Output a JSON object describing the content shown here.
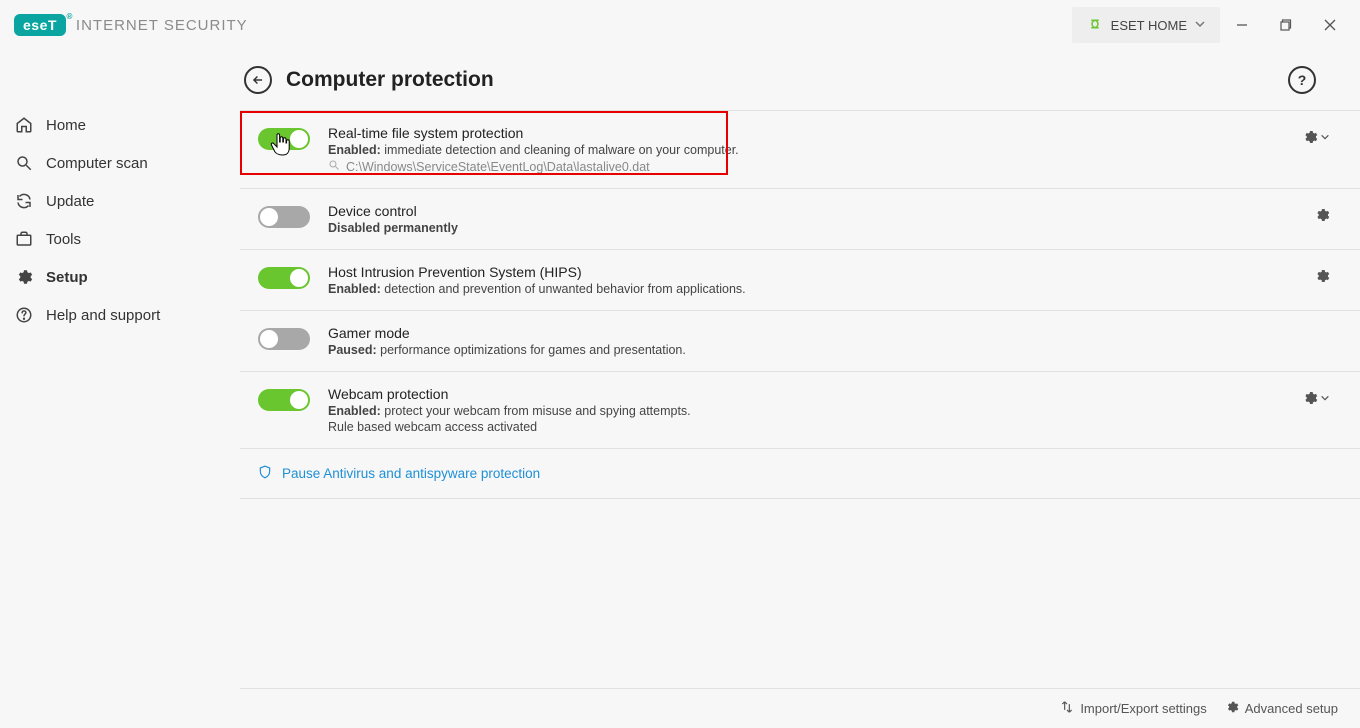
{
  "brand": {
    "logo_text": "eseT",
    "product": "INTERNET SECURITY"
  },
  "titlebar": {
    "home_button": "ESET HOME"
  },
  "sidebar": {
    "items": [
      {
        "label": "Home"
      },
      {
        "label": "Computer scan"
      },
      {
        "label": "Update"
      },
      {
        "label": "Tools"
      },
      {
        "label": "Setup"
      },
      {
        "label": "Help and support"
      }
    ]
  },
  "page": {
    "title": "Computer protection",
    "rows": [
      {
        "title": "Real-time file system protection",
        "status_label": "Enabled:",
        "status_text": "immediate detection and cleaning of malware on your computer.",
        "extra": "C:\\Windows\\ServiceState\\EventLog\\Data\\lastalive0.dat"
      },
      {
        "title": "Device control",
        "status_label": "Disabled permanently",
        "status_text": ""
      },
      {
        "title": "Host Intrusion Prevention System (HIPS)",
        "status_label": "Enabled:",
        "status_text": "detection and prevention of unwanted behavior from applications."
      },
      {
        "title": "Gamer mode",
        "status_label": "Paused:",
        "status_text": "performance optimizations for games and presentation."
      },
      {
        "title": "Webcam protection",
        "status_label": "Enabled:",
        "status_text": "protect your webcam from misuse and spying attempts.",
        "extra2": "Rule based webcam access activated"
      }
    ],
    "pause_link": "Pause Antivirus and antispyware protection"
  },
  "footer": {
    "import_export": "Import/Export settings",
    "advanced": "Advanced setup"
  }
}
